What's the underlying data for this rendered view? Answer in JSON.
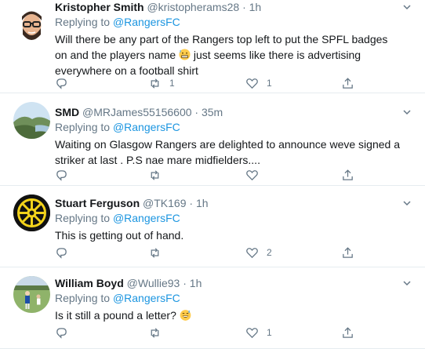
{
  "tweets": [
    {
      "name": "Kristopher Smith",
      "handle": "@kristopherams28",
      "dot": "·",
      "time": "1h",
      "replying_prefix": "Replying to",
      "replying_to": "@RangersFC",
      "text": "Will there be any part of the Rangers top left to put the SPFL badges on and the players name",
      "text_after_emoji": "just seems like there is advertising everywhere on a football shirt",
      "retweets": "1",
      "likes": "1",
      "replies": ""
    },
    {
      "name": "SMD",
      "handle": "@MRJames55156600",
      "dot": "·",
      "time": "35m",
      "replying_prefix": "Replying to",
      "replying_to": "@RangersFC",
      "text": "Waiting on Glasgow Rangers are delighted to announce weve signed a striker at last . P.S nae mare midfielders....",
      "retweets": "",
      "likes": "",
      "replies": ""
    },
    {
      "name": "Stuart Ferguson",
      "handle": "@TK169",
      "dot": "·",
      "time": "1h",
      "replying_prefix": "Replying to",
      "replying_to": "@RangersFC",
      "text": "This is getting out of hand.",
      "retweets": "",
      "likes": "2",
      "replies": ""
    },
    {
      "name": "William Boyd",
      "handle": "@Wullie93",
      "dot": "·",
      "time": "1h",
      "replying_prefix": "Replying to",
      "replying_to": "@RangersFC",
      "text": "Is it still a pound a letter?",
      "retweets": "",
      "likes": "1",
      "replies": ""
    }
  ],
  "colors": {
    "link": "#1b95e0",
    "muted": "#657786",
    "divider": "#e6ecf0"
  }
}
